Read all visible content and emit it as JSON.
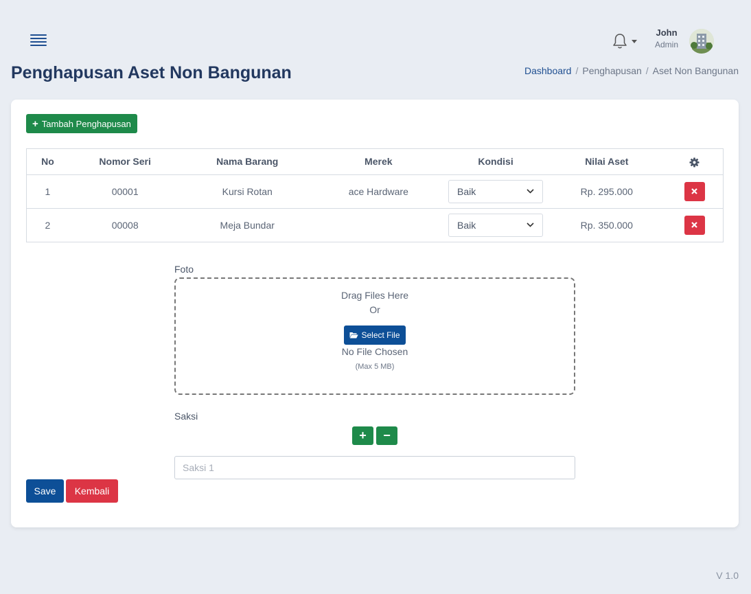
{
  "header": {
    "user_name": "John",
    "user_role": "Admin"
  },
  "page": {
    "title": "Penghapusan Aset Non Bangunan",
    "breadcrumb": [
      "Dashboard",
      "Penghapusan",
      "Aset Non Bangunan"
    ]
  },
  "actions": {
    "add_label": "Tambah Penghapusan",
    "save_label": "Save",
    "back_label": "Kembali"
  },
  "table": {
    "columns": [
      "No",
      "Nomor Seri",
      "Nama Barang",
      "Merek",
      "Kondisi",
      "Nilai Aset"
    ],
    "rows": [
      {
        "no": "1",
        "serial": "00001",
        "name": "Kursi Rotan",
        "brand": "ace Hardware",
        "condition": "Baik",
        "value": "Rp. 295.000"
      },
      {
        "no": "2",
        "serial": "00008",
        "name": "Meja Bundar",
        "brand": "",
        "condition": "Baik",
        "value": "Rp. 350.000"
      }
    ]
  },
  "foto": {
    "label": "Foto",
    "drag_text": "Drag Files Here",
    "or_text": "Or",
    "select_label": "Select File",
    "status": "No File Chosen",
    "limit": "(Max 5 MB)"
  },
  "saksi": {
    "label": "Saksi",
    "placeholder": "Saksi 1",
    "value": ""
  },
  "footer": {
    "version": "V 1.0"
  },
  "colors": {
    "primary": "#0d4f97",
    "success": "#1e8a4a",
    "danger": "#dc3545",
    "title": "#22385f"
  }
}
